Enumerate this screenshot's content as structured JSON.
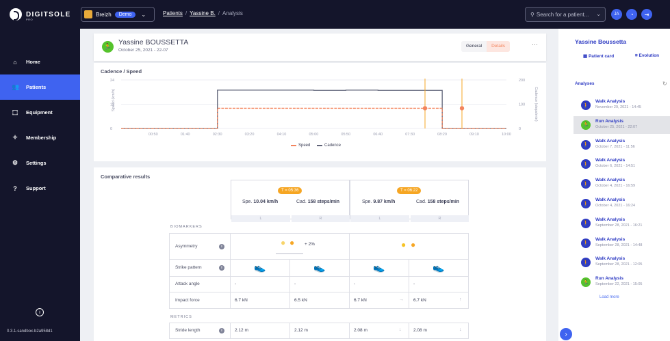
{
  "brand": {
    "name": "DIGITSOLE",
    "sub": "PRO"
  },
  "org": {
    "name": "Breizh",
    "badge": "Demo"
  },
  "breadcrumb": {
    "patients": "Patients",
    "patient": "Yassine B.",
    "current": "Analysis"
  },
  "search": {
    "placeholder": "Search for a patient..."
  },
  "user": {
    "initials": "JA"
  },
  "sidebar": {
    "items": [
      {
        "label": "Home",
        "icon": "home-icon"
      },
      {
        "label": "Patients",
        "icon": "patients-icon"
      },
      {
        "label": "Equipment",
        "icon": "equipment-icon"
      },
      {
        "label": "Membership",
        "icon": "membership-icon"
      },
      {
        "label": "Settings",
        "icon": "settings-icon"
      },
      {
        "label": "Support",
        "icon": "support-icon"
      }
    ],
    "version": "0.3.1-sandbox-b2a958d1"
  },
  "header": {
    "name": "Yassine BOUSSETTA",
    "date": "October 25, 2021 - 22-07",
    "tabs": [
      "General",
      "Details"
    ],
    "active_tab": "Details"
  },
  "colors": {
    "accent": "#3f63f0",
    "speed": "#f3845d",
    "cadence": "#5f6377",
    "marker": "#f6a623"
  },
  "chart_data": {
    "type": "line",
    "title": "Cadence / Speed",
    "ylabel": "Speed (km/h)",
    "y2label": "Cadence (steps/min)",
    "x": [
      "00:50",
      "01:40",
      "02:30",
      "03:20",
      "04:10",
      "05:00",
      "05:50",
      "06:40",
      "07:30",
      "08:20",
      "09:10",
      "10:00"
    ],
    "yticks": [
      0,
      12,
      24
    ],
    "y2ticks": [
      0,
      100,
      200
    ],
    "ylim": [
      0,
      24
    ],
    "y2lim": [
      0,
      200
    ],
    "series": [
      {
        "name": "Speed",
        "axis": "left",
        "values": [
          0,
          0,
          0,
          10,
          10,
          10,
          10,
          10,
          10,
          10,
          0,
          0
        ]
      },
      {
        "name": "Cadence",
        "axis": "right",
        "values": [
          0,
          0,
          0,
          158,
          158,
          158,
          157,
          158,
          157,
          157,
          0,
          0
        ]
      }
    ],
    "markers": [
      {
        "label": "T = 05:36",
        "speed": 10,
        "cadence": 158
      },
      {
        "label": "T = 06:22",
        "speed": 10,
        "cadence": 158
      }
    ],
    "legend": "bottom",
    "grid": true
  },
  "comparative": {
    "title": "Comparative results",
    "t1": {
      "label": "T = 05:36",
      "speed_prefix": "Spe.",
      "speed": "10.04 km/h",
      "cad_prefix": "Cad.",
      "cadence": "158 steps/min",
      "L": "L",
      "R": "R"
    },
    "t2": {
      "label": "T = 06:22",
      "speed_prefix": "Spe.",
      "speed": "9.87 km/h",
      "cad_prefix": "Cad.",
      "cadence": "158 steps/min",
      "L": "L",
      "R": "R"
    },
    "biomarkers_label": "BIOMARKERS",
    "metrics_label": "METRICS",
    "rows": {
      "asymmetry": {
        "label": "Asymmetry",
        "t1_value": "+ 2%"
      },
      "strike": {
        "label": "Strike pattern"
      },
      "attack": {
        "label": "Attack angle",
        "values": [
          "-",
          "-",
          "-",
          "-"
        ]
      },
      "impact": {
        "label": "Impact force",
        "values": [
          "6.7 kN",
          "6.5 kN",
          "6.7 kN",
          "6.7 kN"
        ]
      },
      "stride": {
        "label": "Stride length",
        "values": [
          "2.12 m",
          "2.12 m",
          "2.08 m",
          "2.08 m"
        ]
      }
    }
  },
  "right_panel": {
    "name": "Yassine Boussetta",
    "patient_card": "Patient card",
    "evolution": "Evolution",
    "analyses_label": "Analyses",
    "analyses": [
      {
        "title": "Walk Analysis",
        "date": "November 29, 2021 - 14:45",
        "type": "walk"
      },
      {
        "title": "Run Analysis",
        "date": "October 25, 2021 - 22:07",
        "type": "run"
      },
      {
        "title": "Walk Analysis",
        "date": "October 7, 2021 - 11:56",
        "type": "walk"
      },
      {
        "title": "Walk Analysis",
        "date": "October 6, 2021 - 14:51",
        "type": "walk"
      },
      {
        "title": "Walk Analysis",
        "date": "October 4, 2021 - 16:59",
        "type": "walk"
      },
      {
        "title": "Walk Analysis",
        "date": "October 4, 2021 - 16:24",
        "type": "walk"
      },
      {
        "title": "Walk Analysis",
        "date": "September 28, 2021 - 16:21",
        "type": "walk"
      },
      {
        "title": "Walk Analysis",
        "date": "September 28, 2021 - 14:48",
        "type": "walk"
      },
      {
        "title": "Walk Analysis",
        "date": "September 28, 2021 - 12:05",
        "type": "walk"
      },
      {
        "title": "Run Analysis",
        "date": "September 22, 2021 - 15:05",
        "type": "run"
      }
    ],
    "load_more": "Load more"
  }
}
